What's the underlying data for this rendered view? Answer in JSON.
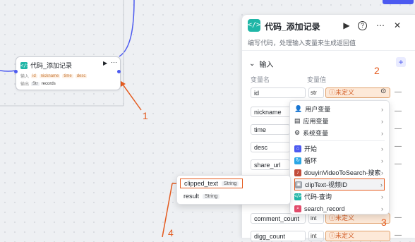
{
  "node": {
    "title": "代码_添加记录",
    "input_label": "输入",
    "inputs": [
      "id",
      "nickname",
      "time",
      "desc"
    ],
    "output_label": "输出",
    "output_type": "Str",
    "output_name": "records"
  },
  "panel": {
    "title": "代码_添加记录",
    "description": "编写代码，处理输入变量来生成返回值",
    "section_title": "输入",
    "col_name": "变量名",
    "col_value": "变量值",
    "rows": [
      {
        "name": "id",
        "type": "str",
        "value": "未定义"
      },
      {
        "name": "nickname",
        "type": "",
        "value": ""
      },
      {
        "name": "time",
        "type": "",
        "value": ""
      },
      {
        "name": "desc",
        "type": "",
        "value": ""
      },
      {
        "name": "share_url",
        "type": "",
        "value": ""
      },
      {
        "name": "comment_count",
        "type": "int",
        "value": "未定义"
      },
      {
        "name": "digg_count",
        "type": "int",
        "value": "未定义"
      }
    ]
  },
  "dropdown": {
    "items": [
      {
        "label": "用户变量",
        "icon": "user-icon"
      },
      {
        "label": "应用变量",
        "icon": "app-icon"
      },
      {
        "label": "系统变量",
        "icon": "gear-icon"
      },
      {
        "label": "开始",
        "icon": "start-icon"
      },
      {
        "label": "循环",
        "icon": "loop-icon"
      },
      {
        "label": "douyinVideoToSearch-搜索",
        "icon": "plugin-icon"
      },
      {
        "label": "clipText-视频ID",
        "icon": "plugin-icon"
      },
      {
        "label": "代码-查询",
        "icon": "code-icon"
      },
      {
        "label": "search_record",
        "icon": "search-icon"
      }
    ]
  },
  "popover": {
    "rows": [
      {
        "name": "clipped_text",
        "type": "String"
      },
      {
        "name": "result",
        "type": "String"
      }
    ]
  },
  "annotations": {
    "one": "1",
    "two": "2",
    "three": "3",
    "four": "4"
  },
  "colors": {
    "accent": "#e45a1e",
    "code": "#1fb6a7",
    "brand": "#4c5af0"
  }
}
